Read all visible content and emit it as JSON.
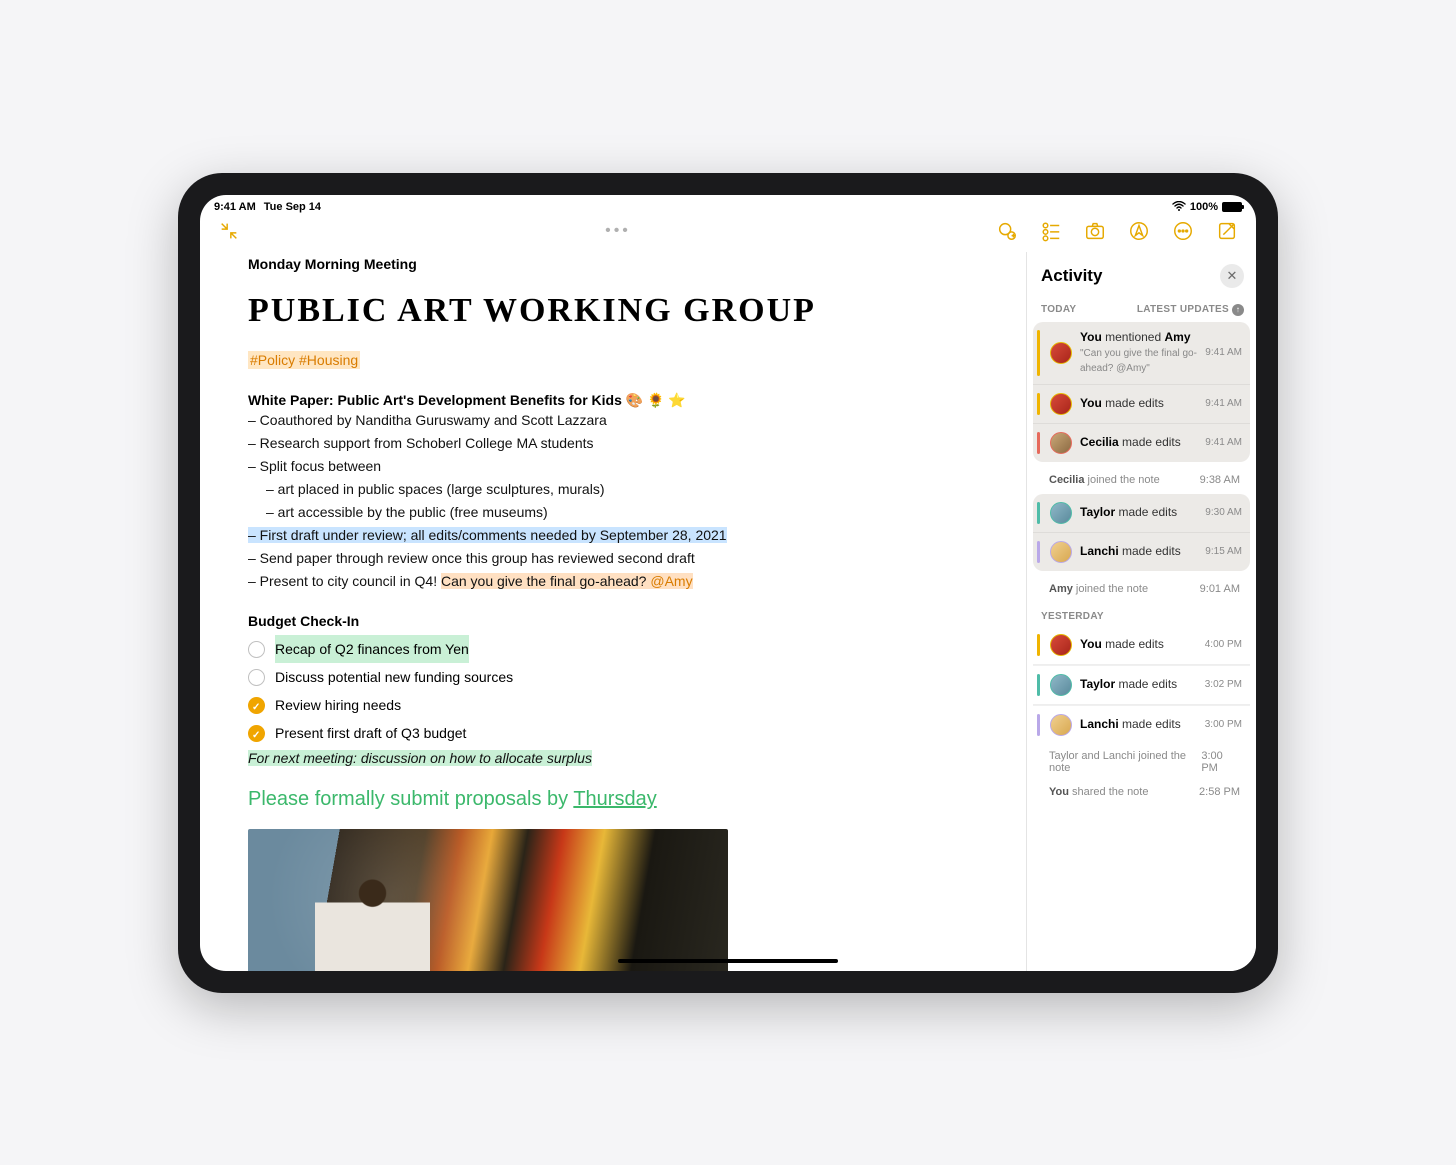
{
  "status": {
    "time": "9:41 AM",
    "date": "Tue Sep 14",
    "wifi": "wifi-icon",
    "battery_pct": "100%"
  },
  "toolbar": {
    "collapse": "collapse-icon",
    "share": "share-icon",
    "list": "list-icon",
    "camera": "camera-icon",
    "markup": "markup-icon",
    "more": "more-icon",
    "compose": "compose-icon"
  },
  "note": {
    "breadcrumb": "Monday Morning Meeting",
    "title": "PUBLIC ART WORKING GROUP",
    "tags": "#Policy #Housing",
    "white_paper_header": "White Paper: Public Art's Development Benefits for Kids 🎨 🌻 ⭐",
    "lines": {
      "l1": "– Coauthored by Nanditha Guruswamy and Scott Lazzara",
      "l2": "– Research support from Schoberl College MA students",
      "l3": "– Split focus between",
      "l3a": "– art placed in public spaces (large sculptures, murals)",
      "l3b": "– art accessible by the public (free museums)",
      "l4": "– First draft under review; all edits/comments needed by September 28, 2021",
      "l5": "– Send paper through review once this group has reviewed second draft",
      "l6a": "– Present to city council in Q4! ",
      "l6b": "Can you give the final go-ahead? ",
      "l6c": "@Amy"
    },
    "budget_header": "Budget Check-In",
    "checklist": {
      "c1": "Recap of Q2 finances from Yen",
      "c2": "Discuss potential new funding sources",
      "c3": "Review hiring needs",
      "c4": "Present first draft of Q3 budget"
    },
    "next_meeting": "For next meeting: discussion on how to allocate surplus",
    "handwriting_a": "Please formally submit proposals by ",
    "handwriting_b": "Thursday"
  },
  "activity": {
    "title": "Activity",
    "today_label": "TODAY",
    "latest_label": "LATEST UPDATES",
    "yesterday_label": "YESTERDAY",
    "items": {
      "t1_actor": "You",
      "t1_verb": " mentioned ",
      "t1_target": "Amy",
      "t1_quote": "\"Can you give the final go-ahead? @Amy\"",
      "t1_time": "9:41 AM",
      "t2_actor": "You",
      "t2_verb": " made edits",
      "t2_time": "9:41 AM",
      "t3_actor": "Cecilia",
      "t3_verb": " made edits",
      "t3_time": "9:41 AM",
      "p1_actor": "Cecilia",
      "p1_verb": " joined the note",
      "p1_time": "9:38 AM",
      "t4_actor": "Taylor",
      "t4_verb": " made edits",
      "t4_time": "9:30 AM",
      "t5_actor": "Lanchi",
      "t5_verb": " made edits",
      "t5_time": "9:15 AM",
      "p2_actor": "Amy",
      "p2_verb": " joined the note",
      "p2_time": "9:01 AM",
      "y1_actor": "You",
      "y1_verb": " made edits",
      "y1_time": "4:00 PM",
      "y2_actor": "Taylor",
      "y2_verb": " made edits",
      "y2_time": "3:02 PM",
      "y3_actor": "Lanchi",
      "y3_verb": " made edits",
      "y3_time": "3:00 PM",
      "p3_text": "Taylor and Lanchi joined the note",
      "p3_time": "3:00 PM",
      "p4_actor": "You",
      "p4_verb": " shared the note",
      "p4_time": "2:58 PM"
    }
  }
}
